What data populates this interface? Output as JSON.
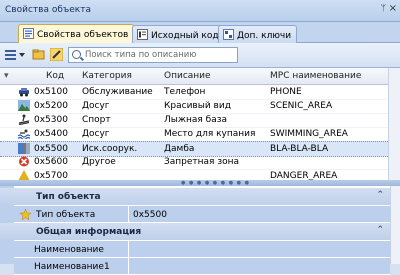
{
  "panel": {
    "title": "Свойства объекта",
    "pin": "ᛘ",
    "close": "×"
  },
  "tabs": [
    {
      "label": "Свойства объектов"
    },
    {
      "label": "Исходный код"
    },
    {
      "label": "Доп. ключи"
    }
  ],
  "search": {
    "placeholder": "Поиск типа по описанию"
  },
  "grid": {
    "columns": [
      "Код",
      "Категория",
      "Описание",
      "МРС наименование"
    ],
    "rows": [
      {
        "icon": "car-icon",
        "code": "0x5100",
        "category": "Обслуживание",
        "description": "Телефон",
        "mpc": "PHONE"
      },
      {
        "icon": "landscape-icon",
        "code": "0x5200",
        "category": "Досуг",
        "description": "Красивый вид",
        "mpc": "SCENIC_AREA"
      },
      {
        "icon": "ski-icon",
        "code": "0x5300",
        "category": "Спорт",
        "description": "Лыжная база",
        "mpc": ""
      },
      {
        "icon": "swimmer-icon",
        "code": "0x5400",
        "category": "Досуг",
        "description": "Место для купания",
        "mpc": "SWIMMING_AREA"
      },
      {
        "icon": "dam-icon",
        "code": "0x5500",
        "category": "Иск.соорук.",
        "description": "Дамба",
        "mpc": "BLA-BLA-BLA",
        "selected": true
      },
      {
        "icon": "no-entry-icon",
        "code": "0x5600",
        "category": "Другое",
        "description": "Запретная зона",
        "mpc": ""
      },
      {
        "icon": "danger-icon",
        "code": "0x5700",
        "category": "",
        "description": "",
        "mpc": "DANGER_AREA"
      }
    ]
  },
  "properties": {
    "cat_type": "Тип объекта",
    "type_label": "Тип объекта",
    "type_value": "0x5500",
    "cat_general": "Общая информация",
    "name_label": "Наименование",
    "name2_label": "Наименование1"
  },
  "colors": {
    "selection": "#d9e6f7",
    "prop_bg": "#bcd0ee",
    "accent": "#15305e"
  }
}
